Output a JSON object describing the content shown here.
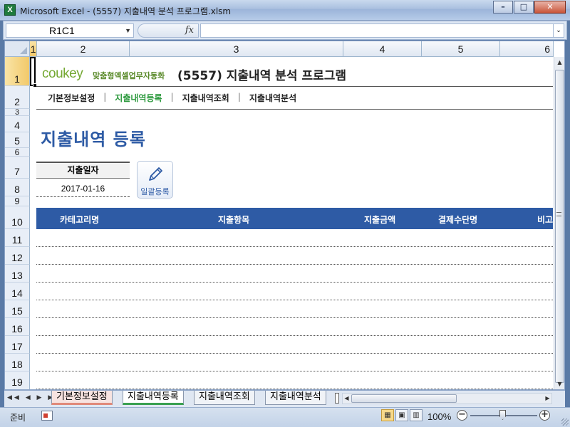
{
  "window": {
    "title": "Microsoft Excel - (5557) 지출내역 분석 프로그램.xlsm",
    "minimize": "–",
    "maximize": "□",
    "close": "✕"
  },
  "formula_bar": {
    "name_box": "R1C1",
    "fx": "fx",
    "formula": ""
  },
  "grid": {
    "column_headers": [
      "1",
      "2",
      "3",
      "4",
      "5",
      "6"
    ],
    "row_headers": [
      "1",
      "2",
      "3",
      "4",
      "5",
      "6",
      "7",
      "8",
      "9",
      "10",
      "11",
      "12",
      "13",
      "14",
      "15",
      "16",
      "17",
      "18",
      "19"
    ]
  },
  "sheet": {
    "logo": "coukey",
    "logo_sub": "맞춤형엑셀업무자동화",
    "app_title": "(5557) 지출내역 분석 프로그램",
    "menu": [
      {
        "label": "기본정보설정",
        "active": false
      },
      {
        "label": "지출내역등록",
        "active": true
      },
      {
        "label": "지출내역조회",
        "active": false
      },
      {
        "label": "지출내역분석",
        "active": false
      }
    ],
    "menu_separator": "|",
    "page_heading": "지출내역 등록",
    "date_label": "지출일자",
    "date_value": "2017-01-16",
    "bulk_register_label": "일괄등록",
    "table_headers": [
      "카테고리명",
      "지출항목",
      "지출금액",
      "결제수단명",
      "비고"
    ]
  },
  "sheet_tabs": [
    {
      "label": "기본정보설정",
      "state": "colored"
    },
    {
      "label": "지출내역등록",
      "state": "active"
    },
    {
      "label": "지출내역조회",
      "state": "normal"
    },
    {
      "label": "지출내역분석",
      "state": "normal"
    }
  ],
  "status_bar": {
    "mode": "준비",
    "zoom": "100%",
    "zoom_minus": "−",
    "zoom_plus": "+"
  },
  "colors": {
    "accent_blue": "#2e5ba5",
    "active_menu_green": "#2d9a3e",
    "logo_green": "#74a832"
  }
}
